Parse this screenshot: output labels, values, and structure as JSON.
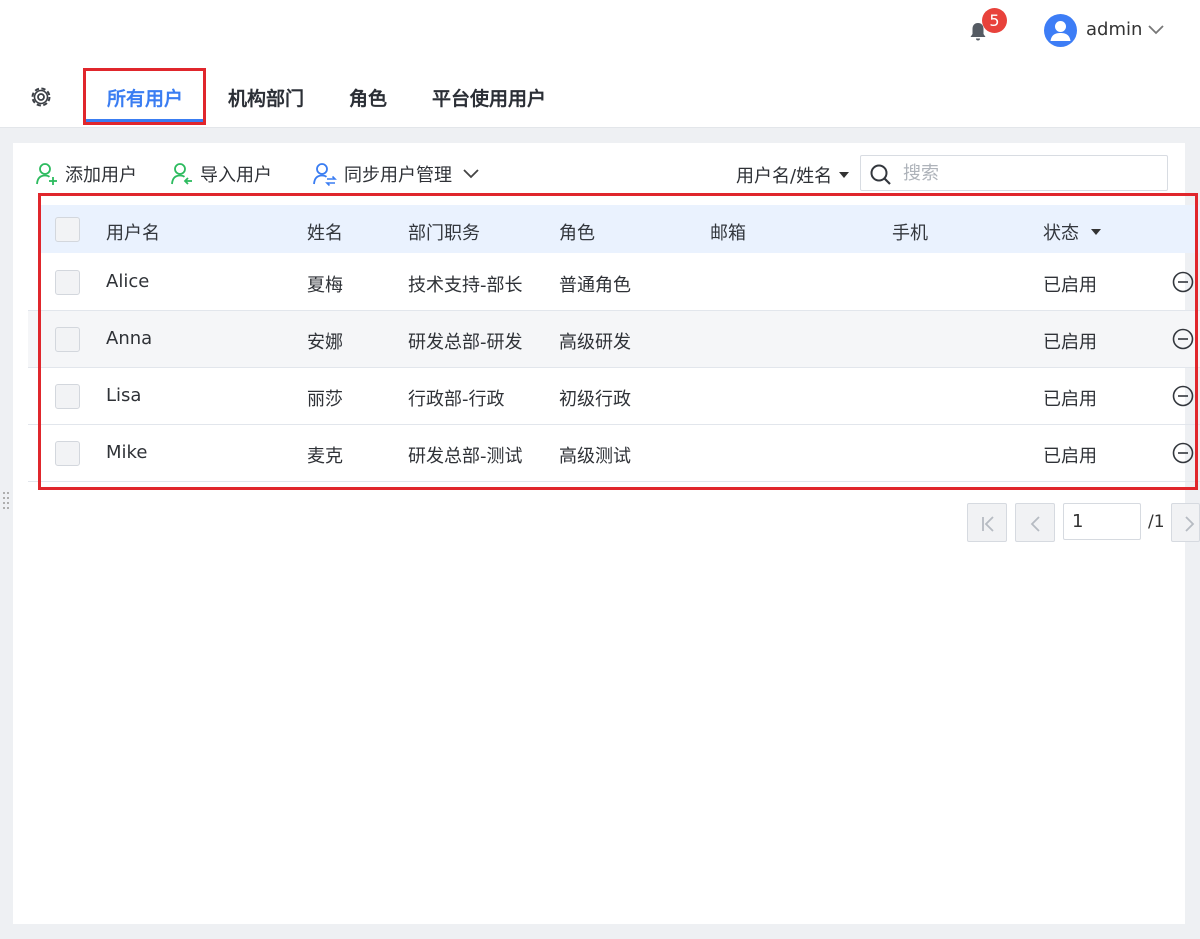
{
  "header": {
    "notification_count": "5",
    "username": "admin"
  },
  "tabs": [
    {
      "label": "所有用户",
      "active": true
    },
    {
      "label": "机构部门",
      "active": false
    },
    {
      "label": "角色",
      "active": false
    },
    {
      "label": "平台使用用户",
      "active": false
    }
  ],
  "toolbar": {
    "add_user": "添加用户",
    "import_user": "导入用户",
    "sync_user_manage": "同步用户管理",
    "search_field": "用户名/姓名",
    "search_placeholder": "搜索"
  },
  "table": {
    "columns": [
      "用户名",
      "姓名",
      "部门职务",
      "角色",
      "邮箱",
      "手机",
      "状态"
    ],
    "rows": [
      {
        "username": "Alice",
        "name": "夏梅",
        "dept": "技术支持-部长",
        "role": "普通角色",
        "email": "",
        "phone": "",
        "status": "已启用"
      },
      {
        "username": "Anna",
        "name": "安娜",
        "dept": "研发总部-研发",
        "role": "高级研发",
        "email": "",
        "phone": "",
        "status": "已启用"
      },
      {
        "username": "Lisa",
        "name": "丽莎",
        "dept": "行政部-行政",
        "role": "初级行政",
        "email": "",
        "phone": "",
        "status": "已启用"
      },
      {
        "username": "Mike",
        "name": "麦克",
        "dept": "研发总部-测试",
        "role": "高级测试",
        "email": "",
        "phone": "",
        "status": "已启用"
      }
    ]
  },
  "pagination": {
    "current_page": "1",
    "total_pages": "/1"
  },
  "colors": {
    "accent": "#3a7df2",
    "highlight_box": "#e0262c",
    "badge": "#e8423b",
    "header_row": "#eaf2fe"
  }
}
